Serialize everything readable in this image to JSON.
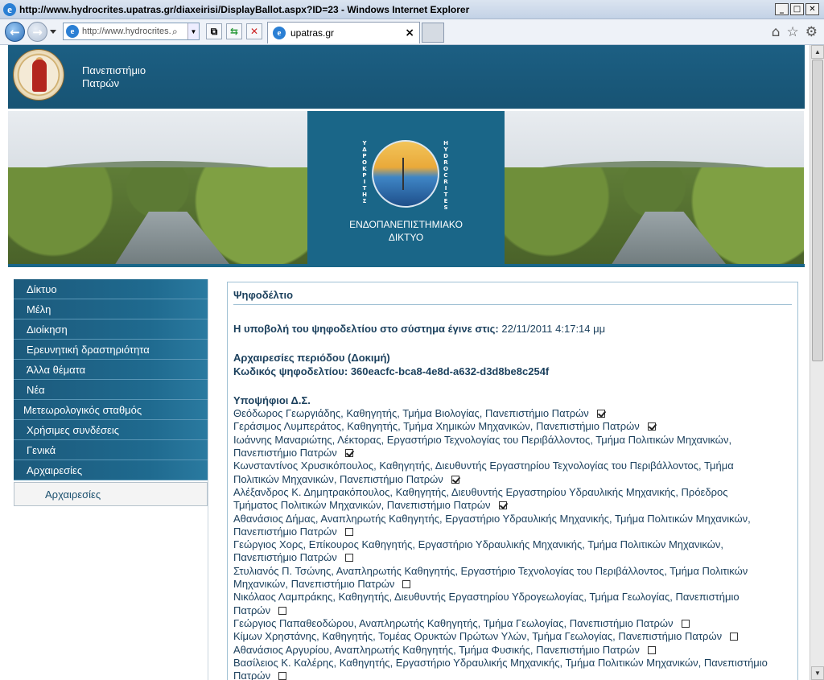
{
  "window": {
    "title": "http://www.hydrocrites.upatras.gr/diaxeirisi/DisplayBallot.aspx?ID=23 - Windows Internet Explorer",
    "address": "http://www.hydrocrites.",
    "tab_label": "upatras.gr",
    "tab_close": "×"
  },
  "site": {
    "university_line1": "Πανεπιστήμιο",
    "university_line2": "Πατρών",
    "logo_left_text": "ΥΔΡΟΚΡΙΤΗΣ",
    "logo_right_text": "HYDROCRITES",
    "network_line1": "ΕΝΔΟΠΑΝΕΠΙΣΤΗΜΙΑΚΟ",
    "network_line2": "ΔΙΚΤΥΟ"
  },
  "sidebar": {
    "items": [
      {
        "label": "Δίκτυο"
      },
      {
        "label": "Μέλη"
      },
      {
        "label": "Διοίκηση"
      },
      {
        "label": "Ερευνητική δραστηριότητα"
      },
      {
        "label": "Άλλα θέματα"
      },
      {
        "label": "Νέα"
      },
      {
        "label": "Μετεωρολογικός σταθμός"
      },
      {
        "label": "Χρήσιμες συνδέσεις"
      },
      {
        "label": "Γενικά"
      },
      {
        "label": "Αρχαιρεσίες"
      }
    ],
    "submenu": {
      "label": "Αρχαιρεσίες"
    }
  },
  "main": {
    "panel_title": "Ψηφοδέλτιο",
    "submitted_label": "Η υποβολή του ψηφοδελτίου στο σύστημα έγινε στις:",
    "submitted_value": "22/11/2011 4:17:14 μμ",
    "election_title": "Αρχαιρεσίες περιόδου (Δοκιμή)",
    "ballot_code": "Κωδικός ψηφοδελτίου: 360eacfc-bca8-4e8d-a632-d3d8be8c254f",
    "candidates_header": "Υποψήφιοι Δ.Σ.",
    "candidates": [
      {
        "line1": "Θεόδωρος Γεωργιάδης, Καθηγητής, Τμήμα Βιολογίας, Πανεπιστήμιο Πατρών",
        "line2": "",
        "checked": true
      },
      {
        "line1": "Γεράσιμος Λυμπεράτος, Καθηγητής, Τμήμα Χημικών Μηχανικών, Πανεπιστήμιο Πατρών",
        "line2": "",
        "checked": true
      },
      {
        "line1": "Ιωάννης Μαναριώτης, Λέκτορας, Εργαστήριο Τεχνολογίας του Περιβάλλοντος, Τμήμα Πολιτικών Μηχανικών,",
        "line2": "Πανεπιστήμιο Πατρών",
        "checked": true
      },
      {
        "line1": "Κωνσταντίνος Χρυσικόπουλος, Καθηγητής, Διευθυντής Εργαστηρίου Τεχνολογίας του Περιβάλλοντος, Τμήμα",
        "line2": "Πολιτικών Μηχανικών, Πανεπιστήμιο Πατρών",
        "checked": true
      },
      {
        "line1": "Αλέξανδρος Κ. Δημητρακόπουλος, Καθηγητής, Διευθυντής Εργαστηρίου Υδραυλικής Μηχανικής,  Πρόεδρος",
        "line2": "Τμήματος Πολιτικών Μηχανικών,  Πανεπιστήμιο Πατρών",
        "checked": true
      },
      {
        "line1": "Αθανάσιος Δήμας, Αναπληρωτής Καθηγητής, Εργαστήριο Υδραυλικής Μηχανικής, Τμήμα Πολιτικών Μηχανικών,",
        "line2": "Πανεπιστήμιο Πατρών",
        "checked": false
      },
      {
        "line1": "Γεώργιος Χορς, Επίκουρος Καθηγητής, Εργαστήριο Υδραυλικής Μηχανικής, Τμήμα Πολιτικών Μηχανικών,",
        "line2": "Πανεπιστήμιο Πατρών",
        "checked": false
      },
      {
        "line1": "Στυλιανός Π. Τσώνης, Αναπληρωτής Καθηγητής, Εργαστήριο Τεχνολογίας του Περιβάλλοντος, Τμήμα Πολιτικών",
        "line2": "Μηχανικών,  Πανεπιστήμιο Πατρών",
        "checked": false
      },
      {
        "line1": "Νικόλαος Λαμπράκης, Καθηγητής, Διευθυντής Εργαστηρίου Υδρογεωλογίας, Τμήμα Γεωλογίας, Πανεπιστήμιο",
        "line2": "Πατρών",
        "checked": false
      },
      {
        "line1": "Γεώργιος Παπαθεοδώρου, Αναπληρωτής Καθηγητής, Τμήμα Γεωλογίας, Πανεπιστήμιο Πατρών",
        "line2": "",
        "checked": false
      },
      {
        "line1": "Κίμων Χρηστάνης, Καθηγητής, Τομέας Ορυκτών Πρώτων Υλών, Τμήμα Γεωλογίας, Πανεπιστήμιο Πατρών",
        "line2": "",
        "checked": false
      },
      {
        "line1": "Αθανάσιος Αργυρίου, Αναπληρωτής Καθηγητής, Τμήμα Φυσικής, Πανεπιστήμιο Πατρών",
        "line2": "",
        "checked": false
      },
      {
        "line1": "Βασίλειος Κ. Καλέρης, Καθηγητής, Εργαστήριο Υδραυλικής Μηχανικής, Τμήμα Πολιτικών Μηχανικών,  Πανεπιστήμιο",
        "line2": "Πατρών",
        "checked": false
      }
    ]
  },
  "colors": {
    "header_blue": "#1c5f83",
    "menu_blue": "#1f6a8f",
    "text_navy": "#1a3f5c"
  },
  "icons": {
    "back": "back-arrow-icon",
    "forward": "forward-arrow-icon",
    "home": "home-icon",
    "favorites": "star-icon",
    "tools": "gear-icon"
  }
}
